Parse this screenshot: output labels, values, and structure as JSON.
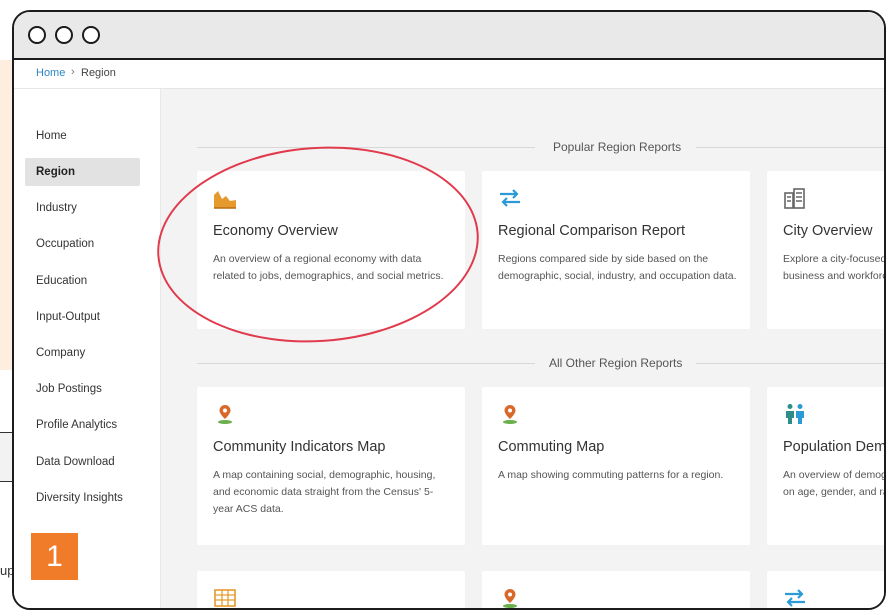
{
  "breadcrumb": {
    "home": "Home",
    "separator": "›",
    "current": "Region"
  },
  "sidebar": {
    "items": [
      {
        "label": "Home"
      },
      {
        "label": "Region",
        "active": true
      },
      {
        "label": "Industry"
      },
      {
        "label": "Occupation"
      },
      {
        "label": "Education"
      },
      {
        "label": "Input-Output"
      },
      {
        "label": "Company"
      },
      {
        "label": "Job Postings"
      },
      {
        "label": "Profile Analytics"
      },
      {
        "label": "Data Download"
      },
      {
        "label": "Diversity Insights"
      }
    ]
  },
  "sections": {
    "popular": "Popular Region Reports",
    "other": "All Other Region Reports"
  },
  "popular_cards": [
    {
      "icon": "area-chart-icon",
      "title": "Economy Overview",
      "description": "An overview of a regional economy with data related to jobs, demographics, and social metrics."
    },
    {
      "icon": "compare-arrows-icon",
      "title": "Regional Comparison Report",
      "description": "Regions compared side by side based on the demographic, social, industry, and occupation data."
    },
    {
      "icon": "city-buildings-icon",
      "title": "City Overview",
      "description": "Explore a city-focused view featuring data on business and workforce characteristics."
    }
  ],
  "other_cards": [
    {
      "icon": "map-pin-icon",
      "title": "Community Indicators Map",
      "description": "A map containing social, demographic, housing, and economic data straight from the Census' 5-year ACS data."
    },
    {
      "icon": "map-pin-icon",
      "title": "Commuting Map",
      "description": "A map showing commuting patterns for a region."
    },
    {
      "icon": "people-icon",
      "title": "Population Demographics",
      "description": "An overview of demographics in a region with data on age, gender, and race/ethnicity."
    }
  ],
  "bottom_row_icons": [
    "table-icon",
    "map-pin-icon",
    "compare-arrows-icon"
  ],
  "step_badge": "1",
  "background_text": "up",
  "colors": {
    "accent_link": "#2d86c5",
    "highlight_circle": "#e03a4c",
    "badge": "#f07c2a",
    "icon_orange": "#e69a2e",
    "icon_blue": "#2d9ad8",
    "pin": "#d9692b",
    "people_teal": "#2c8e86"
  }
}
